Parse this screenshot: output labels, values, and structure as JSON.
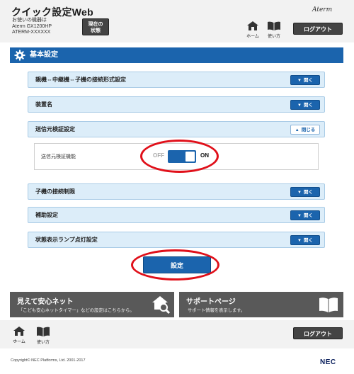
{
  "header": {
    "title": "クイック設定Web",
    "device_lines": [
      "お使いの機器は",
      "Aterm GX1200HP",
      "ATERM-XXXXXX"
    ],
    "status_button": [
      "現在の",
      "状態"
    ],
    "brand": "Aterm",
    "nav": {
      "home": "ホーム",
      "usage": "使い方"
    },
    "logout": "ログアウト"
  },
  "section": {
    "title": "基本設定"
  },
  "rows": [
    {
      "label": "親機⇔中継機⇔子機の接続形式設定",
      "button": "開く"
    },
    {
      "label": "装置名",
      "button": "開く"
    },
    {
      "label": "送信元検証設定",
      "button": "閉じる"
    },
    {
      "label": "子機の接続制限",
      "button": "開く"
    },
    {
      "label": "補助設定",
      "button": "開く"
    },
    {
      "label": "状態表示ランプ点灯設定",
      "button": "開く"
    }
  ],
  "panel": {
    "label": "送信元検証機能",
    "off": "OFF",
    "on": "ON",
    "state": "on"
  },
  "submit": "設定",
  "banners": {
    "left": {
      "title": "見えて安心ネット",
      "subtitle": "「こども安心ネットタイマー」などの設定はこちらから。"
    },
    "right": {
      "title": "サポートページ",
      "subtitle": "サポート情報を表示します。"
    }
  },
  "footer": {
    "home": "ホーム",
    "usage": "使い方",
    "logout": "ログアウト",
    "copyright": "Copyright© NEC Platforms, Ltd. 2001-2017",
    "logo": "NEC"
  },
  "colors": {
    "accent": "#1b64ad",
    "row_bg": "#dcedf9",
    "highlight": "#e0101a",
    "dark_button": "#444444"
  }
}
